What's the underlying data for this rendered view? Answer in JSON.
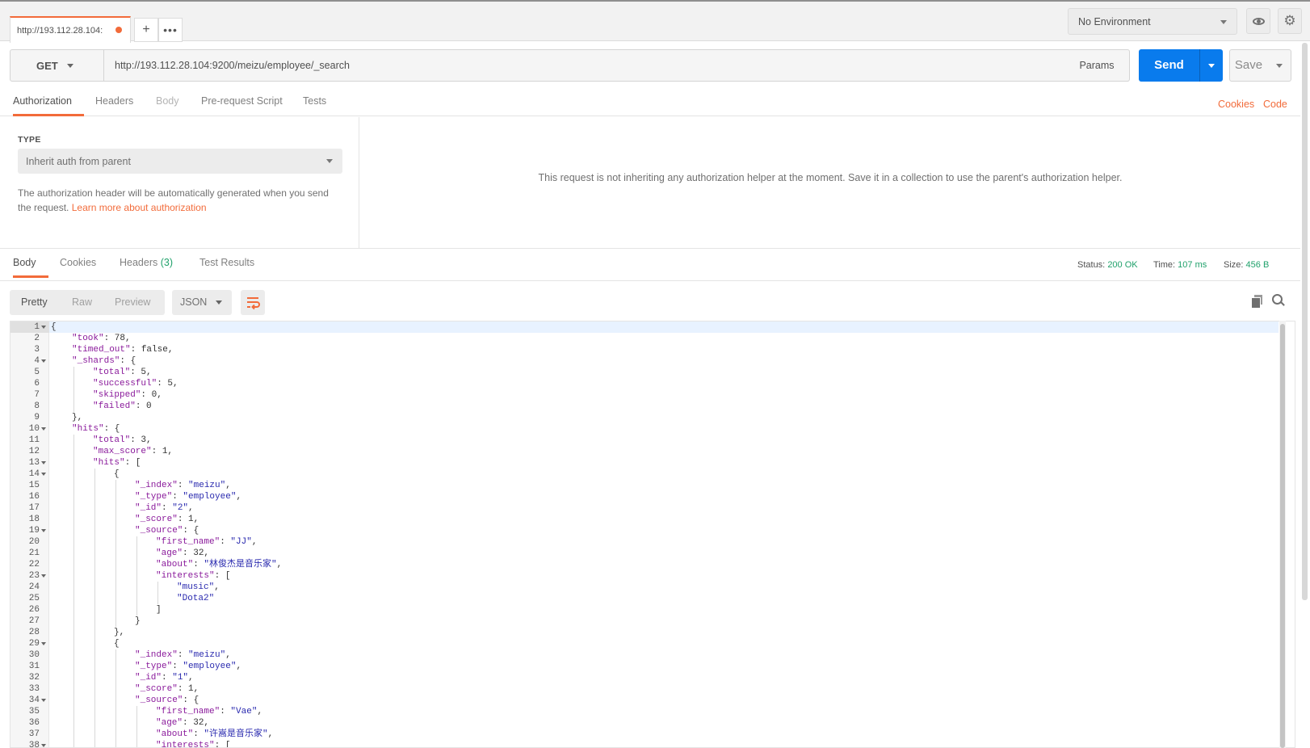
{
  "tabs": {
    "request_tab_label": "http://193.112.28.104:",
    "add_label": "+",
    "more_label": "•••"
  },
  "environment": {
    "selected": "No Environment"
  },
  "request": {
    "method": "GET",
    "url": "http://193.112.28.104:9200/meizu/employee/_search",
    "params_label": "Params",
    "send_label": "Send",
    "save_label": "Save"
  },
  "request_tabs": {
    "authorization": "Authorization",
    "headers": "Headers",
    "body": "Body",
    "pre_request": "Pre-request Script",
    "tests": "Tests",
    "cookies_link": "Cookies",
    "code_link": "Code"
  },
  "auth": {
    "type_label": "TYPE",
    "type_value": "Inherit auth from parent",
    "help_text": "The authorization header will be automatically generated when you send the request.",
    "help_link": "Learn more about authorization",
    "message": "This request is not inheriting any authorization helper at the moment. Save it in a collection to use the parent's authorization helper."
  },
  "response_tabs": {
    "body": "Body",
    "cookies": "Cookies",
    "headers": "Headers",
    "headers_count": "(3)",
    "test_results": "Test Results"
  },
  "status": {
    "status_label": "Status:",
    "status_value": "200 OK",
    "time_label": "Time:",
    "time_value": "107 ms",
    "size_label": "Size:",
    "size_value": "456 B"
  },
  "body_toolbar": {
    "pretty": "Pretty",
    "raw": "Raw",
    "preview": "Preview",
    "format": "JSON"
  },
  "colors": {
    "accent": "#f26b3a",
    "send": "#097bed",
    "status_green": "#20a16b",
    "json_key": "#8a1a9b",
    "json_string": "#2a2aaf"
  },
  "code": [
    {
      "n": "1",
      "fold": true,
      "indent": 0,
      "parts": [
        [
          "p",
          "{"
        ]
      ]
    },
    {
      "n": "2",
      "fold": false,
      "indent": 1,
      "parts": [
        [
          "k",
          "\"took\""
        ],
        [
          "p",
          ": 78,"
        ]
      ]
    },
    {
      "n": "3",
      "fold": false,
      "indent": 1,
      "parts": [
        [
          "k",
          "\"timed_out\""
        ],
        [
          "p",
          ": false,"
        ]
      ]
    },
    {
      "n": "4",
      "fold": true,
      "indent": 1,
      "parts": [
        [
          "k",
          "\"_shards\""
        ],
        [
          "p",
          ": {"
        ]
      ]
    },
    {
      "n": "5",
      "fold": false,
      "indent": 2,
      "parts": [
        [
          "k",
          "\"total\""
        ],
        [
          "p",
          ": 5,"
        ]
      ]
    },
    {
      "n": "6",
      "fold": false,
      "indent": 2,
      "parts": [
        [
          "k",
          "\"successful\""
        ],
        [
          "p",
          ": 5,"
        ]
      ]
    },
    {
      "n": "7",
      "fold": false,
      "indent": 2,
      "parts": [
        [
          "k",
          "\"skipped\""
        ],
        [
          "p",
          ": 0,"
        ]
      ]
    },
    {
      "n": "8",
      "fold": false,
      "indent": 2,
      "parts": [
        [
          "k",
          "\"failed\""
        ],
        [
          "p",
          ": 0"
        ]
      ]
    },
    {
      "n": "9",
      "fold": false,
      "indent": 1,
      "parts": [
        [
          "p",
          "},"
        ]
      ]
    },
    {
      "n": "10",
      "fold": true,
      "indent": 1,
      "parts": [
        [
          "k",
          "\"hits\""
        ],
        [
          "p",
          ": {"
        ]
      ]
    },
    {
      "n": "11",
      "fold": false,
      "indent": 2,
      "parts": [
        [
          "k",
          "\"total\""
        ],
        [
          "p",
          ": 3,"
        ]
      ]
    },
    {
      "n": "12",
      "fold": false,
      "indent": 2,
      "parts": [
        [
          "k",
          "\"max_score\""
        ],
        [
          "p",
          ": 1,"
        ]
      ]
    },
    {
      "n": "13",
      "fold": true,
      "indent": 2,
      "parts": [
        [
          "k",
          "\"hits\""
        ],
        [
          "p",
          ": ["
        ]
      ]
    },
    {
      "n": "14",
      "fold": true,
      "indent": 3,
      "parts": [
        [
          "p",
          "{"
        ]
      ]
    },
    {
      "n": "15",
      "fold": false,
      "indent": 4,
      "parts": [
        [
          "k",
          "\"_index\""
        ],
        [
          "p",
          ": "
        ],
        [
          "s",
          "\"meizu\""
        ],
        [
          "p",
          ","
        ]
      ]
    },
    {
      "n": "16",
      "fold": false,
      "indent": 4,
      "parts": [
        [
          "k",
          "\"_type\""
        ],
        [
          "p",
          ": "
        ],
        [
          "s",
          "\"employee\""
        ],
        [
          "p",
          ","
        ]
      ]
    },
    {
      "n": "17",
      "fold": false,
      "indent": 4,
      "parts": [
        [
          "k",
          "\"_id\""
        ],
        [
          "p",
          ": "
        ],
        [
          "s",
          "\"2\""
        ],
        [
          "p",
          ","
        ]
      ]
    },
    {
      "n": "18",
      "fold": false,
      "indent": 4,
      "parts": [
        [
          "k",
          "\"_score\""
        ],
        [
          "p",
          ": 1,"
        ]
      ]
    },
    {
      "n": "19",
      "fold": true,
      "indent": 4,
      "parts": [
        [
          "k",
          "\"_source\""
        ],
        [
          "p",
          ": {"
        ]
      ]
    },
    {
      "n": "20",
      "fold": false,
      "indent": 5,
      "parts": [
        [
          "k",
          "\"first_name\""
        ],
        [
          "p",
          ": "
        ],
        [
          "s",
          "\"JJ\""
        ],
        [
          "p",
          ","
        ]
      ]
    },
    {
      "n": "21",
      "fold": false,
      "indent": 5,
      "parts": [
        [
          "k",
          "\"age\""
        ],
        [
          "p",
          ": 32,"
        ]
      ]
    },
    {
      "n": "22",
      "fold": false,
      "indent": 5,
      "parts": [
        [
          "k",
          "\"about\""
        ],
        [
          "p",
          ": "
        ],
        [
          "s",
          "\"林俊杰是音乐家\""
        ],
        [
          "p",
          ","
        ]
      ]
    },
    {
      "n": "23",
      "fold": true,
      "indent": 5,
      "parts": [
        [
          "k",
          "\"interests\""
        ],
        [
          "p",
          ": ["
        ]
      ]
    },
    {
      "n": "24",
      "fold": false,
      "indent": 6,
      "parts": [
        [
          "s",
          "\"music\""
        ],
        [
          "p",
          ","
        ]
      ]
    },
    {
      "n": "25",
      "fold": false,
      "indent": 6,
      "parts": [
        [
          "s",
          "\"Dota2\""
        ]
      ]
    },
    {
      "n": "26",
      "fold": false,
      "indent": 5,
      "parts": [
        [
          "p",
          "]"
        ]
      ]
    },
    {
      "n": "27",
      "fold": false,
      "indent": 4,
      "parts": [
        [
          "p",
          "}"
        ]
      ]
    },
    {
      "n": "28",
      "fold": false,
      "indent": 3,
      "parts": [
        [
          "p",
          "},"
        ]
      ]
    },
    {
      "n": "29",
      "fold": true,
      "indent": 3,
      "parts": [
        [
          "p",
          "{"
        ]
      ]
    },
    {
      "n": "30",
      "fold": false,
      "indent": 4,
      "parts": [
        [
          "k",
          "\"_index\""
        ],
        [
          "p",
          ": "
        ],
        [
          "s",
          "\"meizu\""
        ],
        [
          "p",
          ","
        ]
      ]
    },
    {
      "n": "31",
      "fold": false,
      "indent": 4,
      "parts": [
        [
          "k",
          "\"_type\""
        ],
        [
          "p",
          ": "
        ],
        [
          "s",
          "\"employee\""
        ],
        [
          "p",
          ","
        ]
      ]
    },
    {
      "n": "32",
      "fold": false,
      "indent": 4,
      "parts": [
        [
          "k",
          "\"_id\""
        ],
        [
          "p",
          ": "
        ],
        [
          "s",
          "\"1\""
        ],
        [
          "p",
          ","
        ]
      ]
    },
    {
      "n": "33",
      "fold": false,
      "indent": 4,
      "parts": [
        [
          "k",
          "\"_score\""
        ],
        [
          "p",
          ": 1,"
        ]
      ]
    },
    {
      "n": "34",
      "fold": true,
      "indent": 4,
      "parts": [
        [
          "k",
          "\"_source\""
        ],
        [
          "p",
          ": {"
        ]
      ]
    },
    {
      "n": "35",
      "fold": false,
      "indent": 5,
      "parts": [
        [
          "k",
          "\"first_name\""
        ],
        [
          "p",
          ": "
        ],
        [
          "s",
          "\"Vae\""
        ],
        [
          "p",
          ","
        ]
      ]
    },
    {
      "n": "36",
      "fold": false,
      "indent": 5,
      "parts": [
        [
          "k",
          "\"age\""
        ],
        [
          "p",
          ": 32,"
        ]
      ]
    },
    {
      "n": "37",
      "fold": false,
      "indent": 5,
      "parts": [
        [
          "k",
          "\"about\""
        ],
        [
          "p",
          ": "
        ],
        [
          "s",
          "\"许嵩是音乐家\""
        ],
        [
          "p",
          ","
        ]
      ]
    },
    {
      "n": "38",
      "fold": true,
      "indent": 5,
      "parts": [
        [
          "k",
          "\"interests\""
        ],
        [
          "p",
          ": ["
        ]
      ]
    }
  ]
}
